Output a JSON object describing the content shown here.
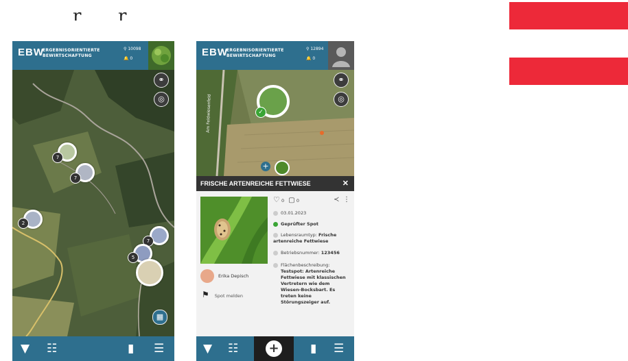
{
  "app": {
    "logo": "EBW",
    "logo_sub_line1": "ERGEBNISORIENTIERTE",
    "logo_sub_line2": "BEWIRTSCHAFTUNG"
  },
  "phone1": {
    "stat_points": "10098",
    "stat_notifications": "0",
    "clusters": [
      {
        "count": "7"
      },
      {
        "count": "7"
      },
      {
        "count": "2"
      },
      {
        "count": "7"
      },
      {
        "count": "5"
      }
    ]
  },
  "phone2": {
    "stat_points": "12894",
    "stat_notifications": "0",
    "street_label": "Am Feldwiesenfeld",
    "sheet_title": "FRISCHE ARTENREICHE FETTWIESE",
    "close_symbol": "✕",
    "likes": "0",
    "comments": "0",
    "date": "03.01.2023",
    "verified": "Geprüfter Spot",
    "habitat_label": "Lebensraumtyp:",
    "habitat_value": "Frische artenreiche Fettwiese",
    "farm_label": "Betriebsnummer:",
    "farm_value": "123456",
    "desc_label": "Flächenbeschreibung:",
    "desc_value": "Testspot: Artenreiche Fettwiese mit klassischen Vertretern wie dem Wiesen-Bocksbart. Es treten keine Störungszeiger auf.",
    "user_name": "Erika Depisch",
    "report_label": "Spot melden",
    "plus_symbol": "+"
  },
  "colors": {
    "brand_blue": "#2e6f8e",
    "flag_red": "#ed2939",
    "flag_white": "#ffffff",
    "verified_green": "#3aa535",
    "dark_bar": "#333333"
  },
  "icons": [
    "binoculars-icon",
    "locate-icon",
    "filter-icon",
    "list-icon",
    "chart-icon",
    "menu-icon",
    "bell-icon",
    "trophy-icon",
    "heart-icon",
    "comment-icon",
    "share-icon",
    "more-icon",
    "calendar-icon",
    "check-icon",
    "folder-icon",
    "flag-icon",
    "plus-icon",
    "close-icon",
    "keyboard-icon"
  ]
}
